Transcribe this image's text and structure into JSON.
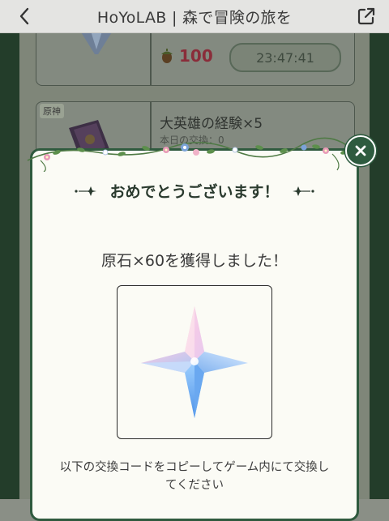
{
  "header": {
    "title": "HoYoLAB | 森で冒険の旅を",
    "back_icon": "chevron-left-icon",
    "share_icon": "share-external-icon"
  },
  "background": {
    "card1": {
      "price": "100",
      "timer": "23:47:41"
    },
    "card2": {
      "tag": "原神",
      "title": "大英雄の経験×5",
      "subtitle": "本日の交換：0"
    }
  },
  "modal": {
    "congrats_title": "おめでとうございます！",
    "reward_text": "原石×60を獲得しました！",
    "description": "以下の交換コードをコピーしてゲーム内にて交換してください",
    "close_icon": "close-icon",
    "item_icon": "primogem-icon"
  },
  "colors": {
    "modal_border": "#2f5a3e",
    "price": "#8a2d3a",
    "background": "#fbfbf5"
  }
}
